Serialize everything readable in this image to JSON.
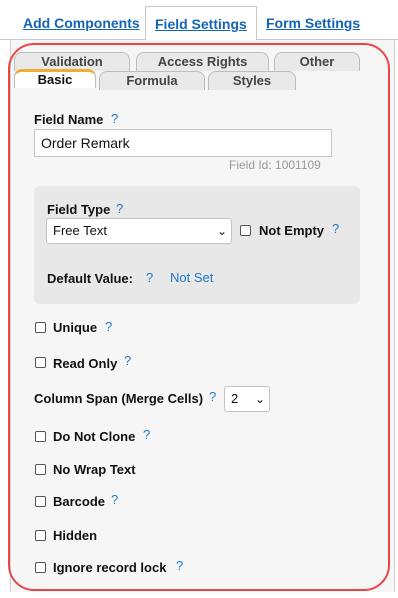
{
  "top_tabs": [
    {
      "label": "Add Components"
    },
    {
      "label": "Field Settings"
    },
    {
      "label": "Form Settings"
    }
  ],
  "sub_tabs_row1": [
    {
      "label": "Validation"
    },
    {
      "label": "Access Rights"
    },
    {
      "label": "Other"
    }
  ],
  "sub_tabs_row2": [
    {
      "label": "Basic"
    },
    {
      "label": "Formula"
    },
    {
      "label": "Styles"
    }
  ],
  "field_name": {
    "label": "Field Name",
    "help": "?",
    "value": "Order Remark",
    "field_id": "Field Id: 1001109"
  },
  "field_type": {
    "label": "Field Type",
    "help": "?",
    "selected": "Free Text",
    "not_empty_label": "Not Empty",
    "not_empty_help": "?"
  },
  "default_value": {
    "label": "Default Value:",
    "help": "?",
    "value": "Not Set"
  },
  "options": [
    {
      "label": "Unique",
      "help": "?"
    },
    {
      "label": "Read Only",
      "help": "?"
    }
  ],
  "column_span": {
    "label": "Column Span (Merge Cells)",
    "help": "?",
    "selected": "2"
  },
  "more_options": [
    {
      "label": "Do Not Clone",
      "help": "?"
    },
    {
      "label": "No Wrap Text",
      "help": ""
    },
    {
      "label": "Barcode",
      "help": "?"
    },
    {
      "label": "Hidden",
      "help": ""
    },
    {
      "label": "Ignore record lock",
      "help": "?"
    }
  ],
  "colors": {
    "link": "#1464b4",
    "help": "#1e78c8",
    "highlight": "#e8474a",
    "active_tab_accent": "#f0ad33"
  }
}
